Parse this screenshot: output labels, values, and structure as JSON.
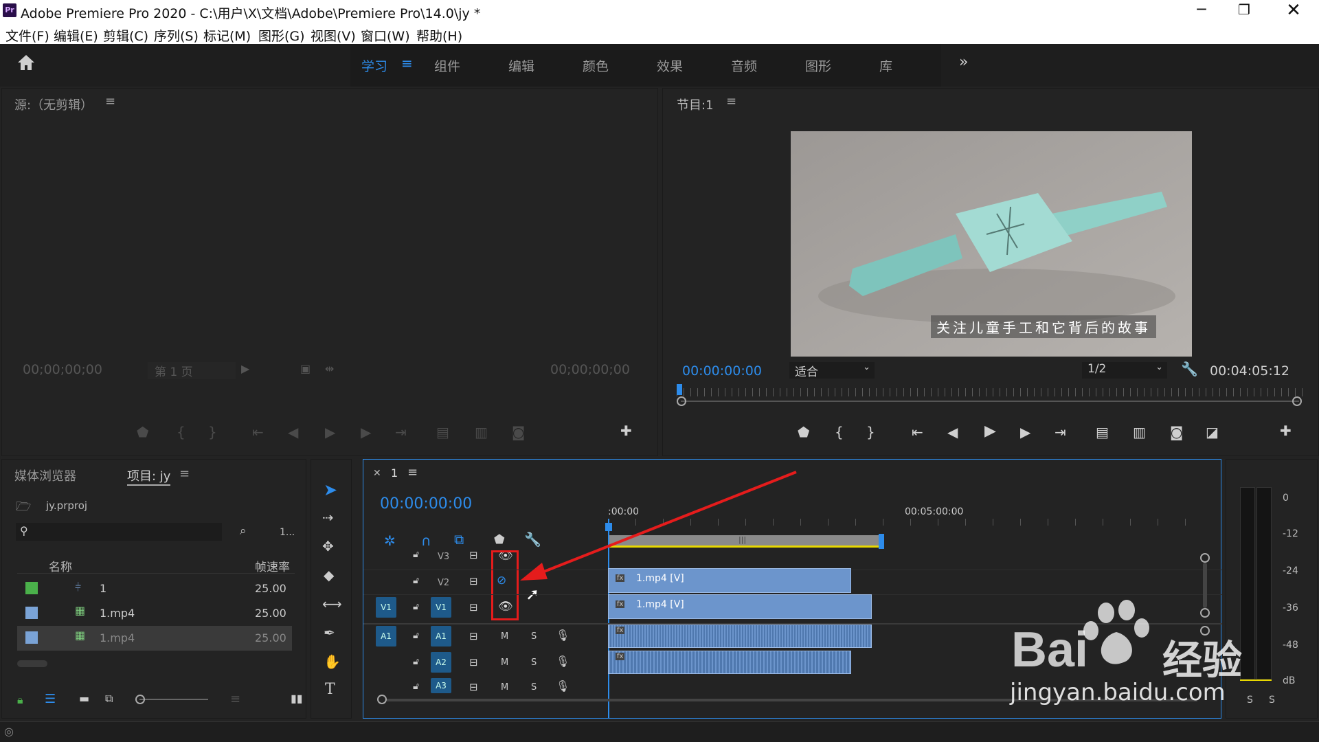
{
  "window": {
    "title": "Adobe Premiere Pro 2020 - C:\\用户\\X\\文档\\Adobe\\Premiere Pro\\14.0\\jy *",
    "app_icon": "Pr"
  },
  "menu": [
    "文件(F)",
    "编辑(E)",
    "剪辑(C)",
    "序列(S)",
    "标记(M)",
    "图形(G)",
    "视图(V)",
    "窗口(W)",
    "帮助(H)"
  ],
  "workspaces": [
    "学习",
    "组件",
    "编辑",
    "颜色",
    "效果",
    "音频",
    "图形",
    "库"
  ],
  "source": {
    "title": "源:（无剪辑）",
    "timecode_left": "00;00;00;00",
    "timecode_right": "00;00;00;00",
    "page_select": "第 1 页"
  },
  "program": {
    "title": "节目:1",
    "timecode": "00:00:00:00",
    "fit": "适合",
    "resolution": "1/2",
    "duration": "00:04:05:12",
    "subtitle": "关注儿童手工和它背后的故事"
  },
  "project": {
    "tab_media_browser": "媒体浏览器",
    "tab_project": "项目: jy",
    "project_file": "jy.prproj",
    "search_placeholder": "",
    "count": "1...",
    "col_name": "名称",
    "col_fps": "帧速率",
    "items": [
      {
        "name": "1",
        "fps": "25.00",
        "color": "#4ab04a"
      },
      {
        "name": "1.mp4",
        "fps": "25.00",
        "color": "#7aa3d6"
      },
      {
        "name": "1.mp4",
        "fps": "25.00",
        "color": "#7aa3d6"
      }
    ]
  },
  "timeline": {
    "tab": "1",
    "timecode": "00:00:00:00",
    "ruler_start": ":00:00",
    "ruler_mid": "00:05:00:00",
    "tracks_video": [
      "V3",
      "V2",
      "V1"
    ],
    "tracks_audio": [
      "A1",
      "A2",
      "A3"
    ],
    "source_patch_v": "V1",
    "source_patch_a": "A1",
    "mute_label": "M",
    "solo_label": "S",
    "clip_v2": "1.mp4 [V]",
    "clip_v1": "1.mp4 [V]",
    "fx_label": "fx"
  },
  "meter": {
    "scale": [
      "0",
      "-12",
      "-24",
      "-36",
      "-48",
      "dB"
    ],
    "solo_left": "S",
    "solo_right": "S"
  },
  "watermark": {
    "text_cn": "经验",
    "text_url": "jingyan.baidu.com"
  },
  "colors": {
    "accent": "#2d8ceb",
    "annotation_red": "#e51c1c",
    "clip_blue": "#6c95cc"
  }
}
